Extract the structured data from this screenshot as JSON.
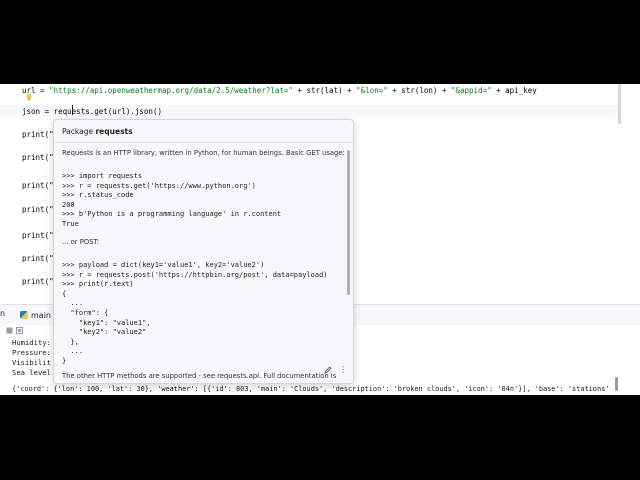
{
  "editor": {
    "lines": [
      {
        "segments": [
          {
            "t": "url = ",
            "c": ""
          },
          {
            "t": "\"https://api.openweathermap.org/data/2.5/weather?lat=\"",
            "c": "str"
          },
          {
            "t": " + str(lat) + ",
            "c": ""
          },
          {
            "t": "\"&lon=\"",
            "c": "str"
          },
          {
            "t": " + str(lon) + ",
            "c": ""
          },
          {
            "t": "\"&appid=\"",
            "c": "str"
          },
          {
            "t": " + api_key",
            "c": ""
          }
        ]
      },
      {
        "segments": [
          {
            "t": "json = requests.get(url).json()",
            "c": ""
          }
        ]
      },
      {
        "segments": [
          {
            "t": "print(\"",
            "c": ""
          }
        ]
      },
      {
        "segments": [
          {
            "t": "print(\"",
            "c": ""
          }
        ]
      },
      {
        "segments": [
          {
            "t": "print(\"",
            "c": ""
          }
        ]
      },
      {
        "segments": [
          {
            "t": "print(\"",
            "c": ""
          }
        ]
      },
      {
        "segments": [
          {
            "t": "print(\"",
            "c": ""
          }
        ]
      },
      {
        "segments": [
          {
            "t": "print(\"",
            "c": ""
          }
        ]
      },
      {
        "segments": [
          {
            "t": "print(\"",
            "c": ""
          }
        ]
      }
    ]
  },
  "run_bar": {
    "left_label": "n",
    "tab_label": "main"
  },
  "console": {
    "lines": [
      "Humidity:",
      "Pressure:",
      "Visibilit",
      "Sea level"
    ],
    "dict_line": "{'coord': {'lon': 100, 'lat': 30}, 'weather': [{'id': 803, 'main': 'Clouds', 'description': 'broken clouds', 'icon': '04n'}], 'base': 'stations'"
  },
  "popup": {
    "title_prefix": "Package ",
    "title_name": "requests",
    "intro": "Requests is an HTTP library, written in Python, for human beings. Basic GET usage:",
    "code1": ">>> import requests\n>>> r = requests.get('https://www.python.org')\n>>> r.status_code\n200\n>>> b'Python is a programming language' in r.content\nTrue",
    "or_post": "... or POST:",
    "code2": ">>> payload = dict(key1='value1', key2='value2')\n>>> r = requests.post('https://httpbin.org/post', data=payload)\n>>> print(r.text)\n{\n  ...\n  \"form\": {\n    \"key1\": \"value1\",\n    \"key2\": \"value2\"\n  },\n  ...\n}",
    "footer_text": "The other HTTP methods are supported - see requests.api. Full documentation is",
    "icons": [
      "edit-icon",
      "more-icon"
    ]
  },
  "colors": {
    "string": "#067d17",
    "background": "#ffffff",
    "popup_bg": "#f7f8fa",
    "letterbox": "#000000"
  }
}
